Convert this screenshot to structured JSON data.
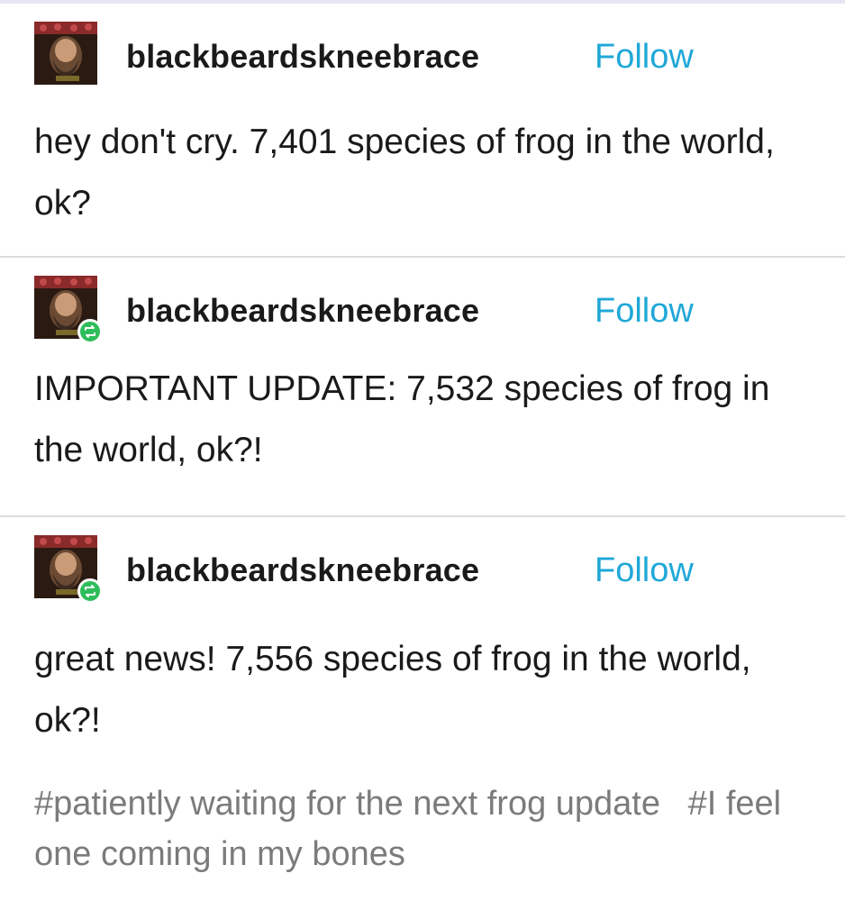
{
  "posts": [
    {
      "username": "blackbeardskneebrace",
      "follow_label": "Follow",
      "reblogged": false,
      "body": "hey don't cry. 7,401 species of frog in the world, ok?"
    },
    {
      "username": "blackbeardskneebrace",
      "follow_label": "Follow",
      "reblogged": true,
      "body": "IMPORTANT UPDATE: 7,532 species of frog in the world, ok?!"
    },
    {
      "username": "blackbeardskneebrace",
      "follow_label": "Follow",
      "reblogged": true,
      "body": "great news! 7,556 species of frog in the world, ok?!",
      "tags": [
        "#patiently waiting for the next frog update",
        "#I feel one coming in my bones"
      ]
    }
  ],
  "icons": {
    "avatar": "avatar-bearded-man",
    "reblog": "reblog-icon"
  },
  "colors": {
    "follow_link": "#1fa8d8",
    "reblog_badge": "#2fbd5b",
    "tags_text": "#7b7b7b",
    "divider": "#dcdcdc"
  }
}
